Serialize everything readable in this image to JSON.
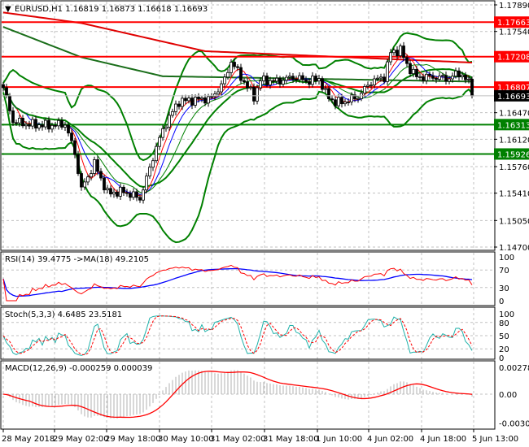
{
  "header": {
    "symbol": "EURUSD,H1",
    "open": "1.16819",
    "high": "1.16873",
    "low": "1.16618",
    "close": "1.16693"
  },
  "price_axis": {
    "ticks": [
      "1.17890",
      "1.17540",
      "1.16470",
      "1.16120",
      "1.15760",
      "1.15410",
      "1.15050",
      "1.14700"
    ],
    "tick_values": [
      1.1789,
      1.1754,
      1.1647,
      1.1612,
      1.1576,
      1.1541,
      1.1505,
      1.147
    ]
  },
  "levels": [
    {
      "label": "1.17663",
      "value": 1.17663,
      "color": "#ff0000"
    },
    {
      "label": "1.17208",
      "value": 1.17208,
      "color": "#ff0000"
    },
    {
      "label": "1.16807",
      "value": 1.16807,
      "color": "#ff0000"
    },
    {
      "label": "1.16313",
      "value": 1.16313,
      "color": "#008000"
    },
    {
      "label": "1.15926",
      "value": 1.15926,
      "color": "#008000"
    }
  ],
  "current_price": {
    "label": "1.16693",
    "value": 1.16693
  },
  "rsi": {
    "label": "RSI(14) 39.4775  ->MA(18) 49.2105",
    "ticks": [
      "100",
      "70",
      "30",
      "0"
    ]
  },
  "stoch": {
    "label": "Stoch(5,3,3) 4.6485 23.5181",
    "ticks": [
      "100",
      "80",
      "50",
      "20",
      "0"
    ]
  },
  "macd": {
    "label": "MACD(12,26,9) -0.000259 0.000039",
    "ticks": [
      "0.002785",
      "0.00",
      "-0.003002"
    ]
  },
  "time_axis": [
    "28 May 2018",
    "29 May 02:00",
    "29 May 18:00",
    "30 May 10:00",
    "31 May 02:00",
    "31 May 18:00",
    "1 Jun 10:00",
    "4 Jun 02:00",
    "4 Jun 18:00",
    "5 Jun 13:00"
  ],
  "chart_data": {
    "type": "candlestick",
    "title": "EURUSD,H1",
    "ylim": [
      1.147,
      1.1789
    ],
    "close_keypoints": [
      [
        0,
        1.168
      ],
      [
        3,
        1.1636
      ],
      [
        7,
        1.1632
      ],
      [
        14,
        1.163
      ],
      [
        19,
        1.1632
      ],
      [
        22,
        1.1594
      ],
      [
        24,
        1.1546
      ],
      [
        28,
        1.158
      ],
      [
        32,
        1.1541
      ],
      [
        37,
        1.1543
      ],
      [
        42,
        1.1534
      ],
      [
        44,
        1.156
      ],
      [
        47,
        1.1602
      ],
      [
        50,
        1.1634
      ],
      [
        54,
        1.1662
      ],
      [
        59,
        1.1664
      ],
      [
        64,
        1.1666
      ],
      [
        68,
        1.169
      ],
      [
        70,
        1.1715
      ],
      [
        73,
        1.1694
      ],
      [
        77,
        1.1668
      ],
      [
        79,
        1.169
      ],
      [
        84,
        1.1688
      ],
      [
        89,
        1.1694
      ],
      [
        94,
        1.1688
      ],
      [
        97,
        1.1692
      ],
      [
        99,
        1.1672
      ],
      [
        102,
        1.166
      ],
      [
        105,
        1.1662
      ],
      [
        109,
        1.1668
      ],
      [
        113,
        1.1688
      ],
      [
        117,
        1.1694
      ],
      [
        119,
        1.1726
      ],
      [
        122,
        1.173
      ],
      [
        124,
        1.171
      ],
      [
        127,
        1.1694
      ],
      [
        132,
        1.1694
      ],
      [
        137,
        1.1692
      ],
      [
        140,
        1.17
      ],
      [
        143,
        1.1686
      ],
      [
        144,
        1.16693
      ]
    ],
    "long_ma_red": [
      [
        0,
        1.1779
      ],
      [
        24,
        1.1765
      ],
      [
        62,
        1.1728
      ],
      [
        144,
        1.1713
      ]
    ],
    "long_ma_green": [
      [
        0,
        1.176
      ],
      [
        24,
        1.172
      ],
      [
        49,
        1.1695
      ],
      [
        144,
        1.1688
      ]
    ]
  }
}
